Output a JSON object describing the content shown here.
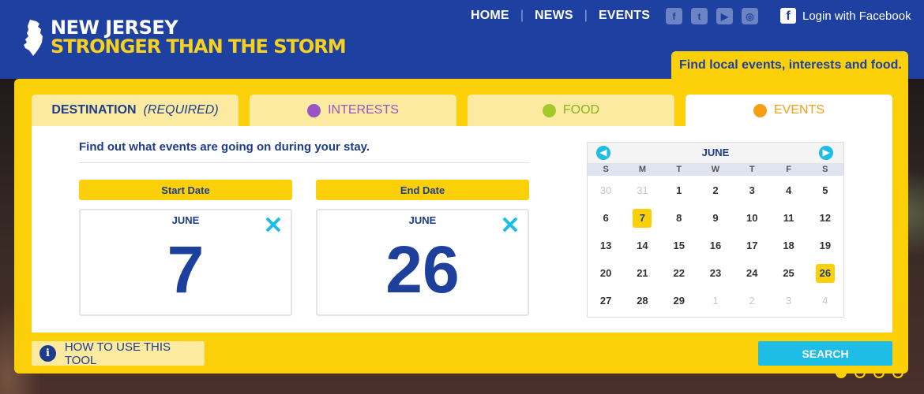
{
  "header": {
    "logo_line1": "NEW JERSEY",
    "logo_line2": "STRONGER THAN THE STORM",
    "nav": [
      {
        "label": "HOME"
      },
      {
        "label": "NEWS"
      },
      {
        "label": "EVENTS"
      }
    ],
    "social_icons": [
      "facebook-icon",
      "twitter-icon",
      "youtube-icon",
      "instagram-icon"
    ],
    "login_label": "Login with Facebook"
  },
  "finder_tag": "Find local events, interests and food.",
  "tabs": {
    "destination_label": "DESTINATION",
    "destination_required": "(REQUIRED)",
    "interests_label": "INTERESTS",
    "food_label": "FOOD",
    "events_label": "EVENTS",
    "active": "EVENTS"
  },
  "colors": {
    "brand_blue": "#1e40a0",
    "accent_yellow": "#fcd008",
    "interests_dot": "#9955c6",
    "food_dot": "#a5c92a",
    "events_dot": "#f59e12",
    "action_cyan": "#1dbde6"
  },
  "events_panel": {
    "intro": "Find out what events are going on during your stay.",
    "start": {
      "label": "Start Date",
      "month": "JUNE",
      "day": "7"
    },
    "end": {
      "label": "End Date",
      "month": "JUNE",
      "day": "26"
    },
    "clear_icon": "close-icon"
  },
  "calendar": {
    "month": "JUNE",
    "weekdays": [
      "S",
      "M",
      "T",
      "W",
      "T",
      "F",
      "S"
    ],
    "days": [
      {
        "d": "30",
        "muted": true
      },
      {
        "d": "31",
        "muted": true
      },
      {
        "d": "1"
      },
      {
        "d": "2"
      },
      {
        "d": "3"
      },
      {
        "d": "4"
      },
      {
        "d": "5"
      },
      {
        "d": "6"
      },
      {
        "d": "7",
        "selected": true
      },
      {
        "d": "8"
      },
      {
        "d": "9"
      },
      {
        "d": "10"
      },
      {
        "d": "11"
      },
      {
        "d": "12"
      },
      {
        "d": "13"
      },
      {
        "d": "14"
      },
      {
        "d": "15"
      },
      {
        "d": "16"
      },
      {
        "d": "17"
      },
      {
        "d": "18"
      },
      {
        "d": "19"
      },
      {
        "d": "20"
      },
      {
        "d": "21"
      },
      {
        "d": "22"
      },
      {
        "d": "23"
      },
      {
        "d": "24"
      },
      {
        "d": "25"
      },
      {
        "d": "26",
        "selected": true
      },
      {
        "d": "27"
      },
      {
        "d": "28"
      },
      {
        "d": "29"
      },
      {
        "d": "1",
        "muted": true
      },
      {
        "d": "2",
        "muted": true
      },
      {
        "d": "3",
        "muted": true
      },
      {
        "d": "4",
        "muted": true
      }
    ]
  },
  "howto_label": "HOW TO USE THIS TOOL",
  "search_label": "SEARCH",
  "pager": {
    "count": 4,
    "active": 1
  }
}
